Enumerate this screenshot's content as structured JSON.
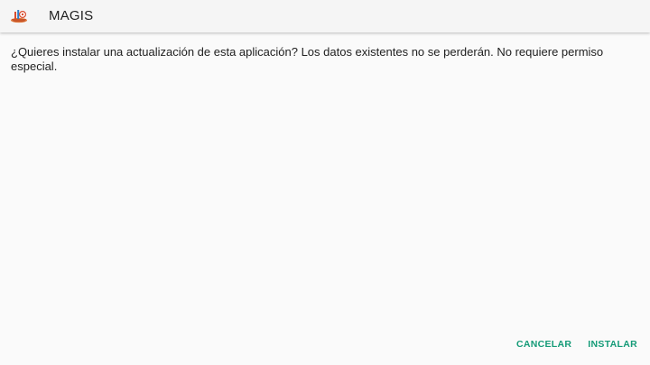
{
  "app_bar": {
    "title": "MAGIS",
    "icon": "magis-app-icon"
  },
  "dialog": {
    "message": "¿Quieres instalar una actualización de esta aplicación? Los datos existentes no se perderán. No requiere permiso especial."
  },
  "actions": {
    "cancel_label": "CANCELAR",
    "install_label": "INSTALAR"
  },
  "colors": {
    "accent": "#159b78",
    "app_bar_bg": "#f5f5f5",
    "background": "#fafafa",
    "text": "#212121"
  }
}
